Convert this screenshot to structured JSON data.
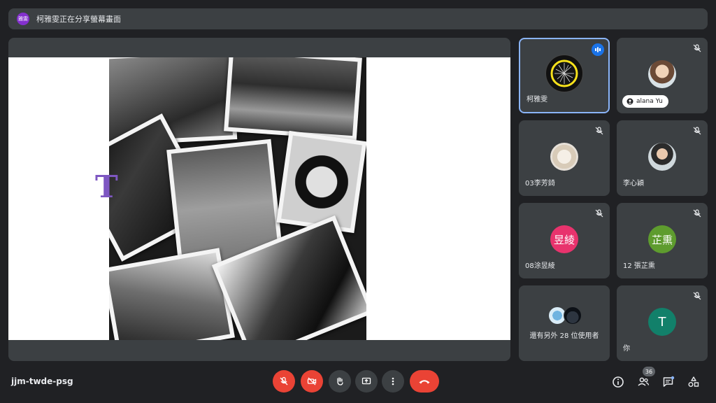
{
  "banner": {
    "avatar_text": "雅雯",
    "text": "柯雅雯正在分享螢幕畫面"
  },
  "presentation": {
    "slide_letter": "T"
  },
  "participants": [
    {
      "name": "柯雅雯",
      "type": "logo",
      "speaking": true
    },
    {
      "name": "alana Yu",
      "type": "photo",
      "label_style": "chip"
    },
    {
      "name": "03李芳錡",
      "type": "photo"
    },
    {
      "name": "李心穎",
      "type": "photo"
    },
    {
      "name": "08涂昱綾",
      "avatar_text": "昱綾",
      "avatar_color": "#e8336d"
    },
    {
      "name": "12 張芷熏",
      "avatar_text": "芷熏",
      "avatar_color": "#5e9c2e"
    },
    {
      "name": "還有另外 28 位使用者",
      "type": "others"
    },
    {
      "name": "你",
      "avatar_text": "T",
      "avatar_color": "#12806a"
    }
  ],
  "footer": {
    "meeting_code": "jjm-twde-psg",
    "participant_count": "36"
  },
  "colors": {
    "accent": "#8ab4f8",
    "danger": "#ea4335",
    "surface": "#3c4043",
    "background": "#202124"
  }
}
